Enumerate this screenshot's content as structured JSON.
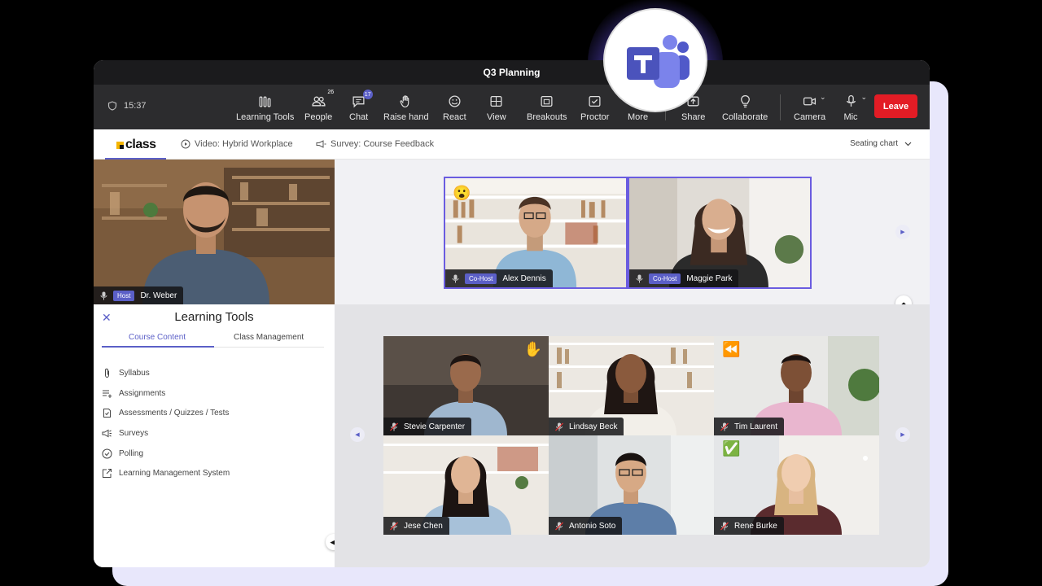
{
  "window": {
    "title": "Q3 Planning"
  },
  "toolbar": {
    "time": "15:37",
    "buttons": [
      {
        "label": "Learning Tools",
        "icon": "bars-icon"
      },
      {
        "label": "People",
        "icon": "people-icon",
        "count": "26"
      },
      {
        "label": "Chat",
        "icon": "chat-icon",
        "count": "17"
      },
      {
        "label": "Raise hand",
        "icon": "hand-icon"
      },
      {
        "label": "React",
        "icon": "smile-icon"
      },
      {
        "label": "View",
        "icon": "view-icon"
      },
      {
        "label": "Breakouts",
        "icon": "breakouts-icon"
      },
      {
        "label": "Proctor",
        "icon": "proctor-icon"
      },
      {
        "label": "More",
        "icon": "more-icon"
      },
      {
        "label": "Share",
        "icon": "share-icon"
      },
      {
        "label": "Collaborate",
        "icon": "bulb-icon"
      },
      {
        "label": "Camera",
        "icon": "camera-icon"
      },
      {
        "label": "Mic",
        "icon": "mic-icon"
      }
    ],
    "leave_label": "Leave"
  },
  "tabs": {
    "logo": "class",
    "video_tab": "Video: Hybrid Workplace",
    "survey_tab": "Survey: Course Feedback",
    "seating": "Seating chart"
  },
  "host": {
    "role": "Host",
    "name": "Dr. Weber"
  },
  "learning_tools": {
    "title": "Learning Tools",
    "tabs": [
      "Course Content",
      "Class Management"
    ],
    "items": [
      {
        "label": "Syllabus",
        "icon": "paperclip-icon"
      },
      {
        "label": "Assignments",
        "icon": "list-add-icon"
      },
      {
        "label": "Assessments / Quizzes / Tests",
        "icon": "clipboard-check-icon"
      },
      {
        "label": "Surveys",
        "icon": "megaphone-icon"
      },
      {
        "label": "Polling",
        "icon": "check-circle-icon"
      },
      {
        "label": "Learning Management System",
        "icon": "external-link-icon"
      }
    ]
  },
  "cohosts": [
    {
      "role": "Co-Host",
      "name": "Alex Dennis",
      "reaction": "😮"
    },
    {
      "role": "Co-Host",
      "name": "Maggie Park"
    }
  ],
  "participants": [
    {
      "name": "Stevie Carpenter",
      "reaction": "✋"
    },
    {
      "name": "Lindsay Beck"
    },
    {
      "name": "Tim Laurent",
      "reaction": "⏪"
    },
    {
      "name": "Jese Chen"
    },
    {
      "name": "Antonio Soto"
    },
    {
      "name": "Rene Burke",
      "reaction": "✅"
    }
  ],
  "colors": {
    "accent": "#5b5fc7",
    "leave": "#e31c25",
    "toolbar": "#2c2c2e"
  }
}
